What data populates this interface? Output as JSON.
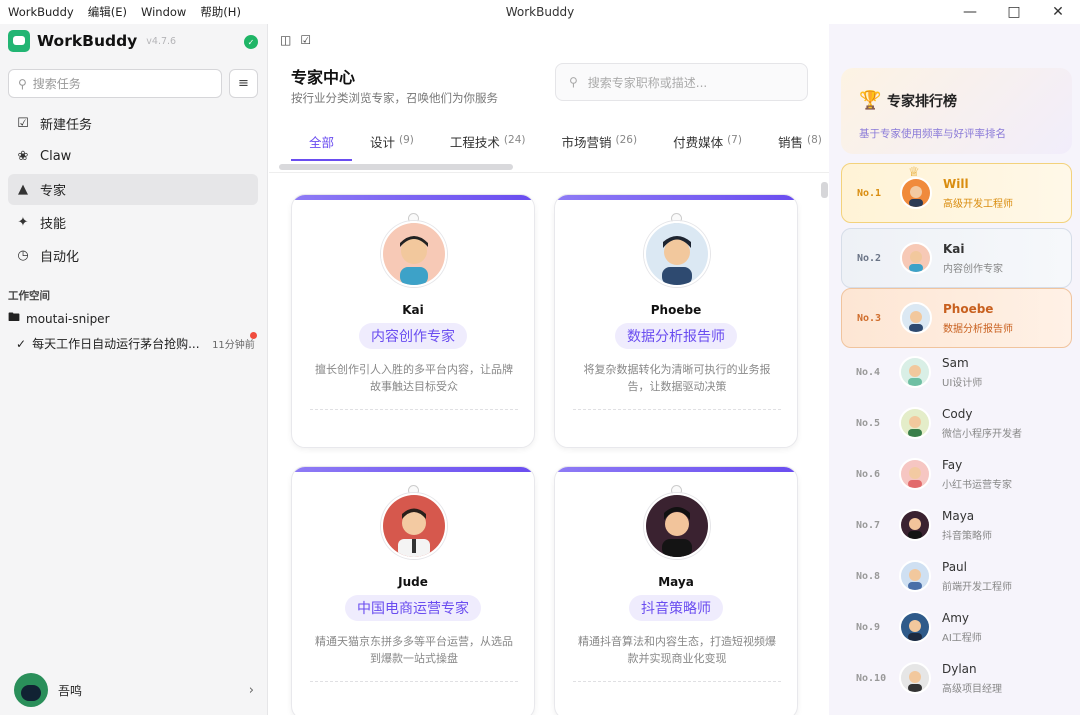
{
  "titlebar": {
    "menu": [
      "WorkBuddy",
      "编辑(E)",
      "Window",
      "帮助(H)"
    ],
    "title": "WorkBuddy"
  },
  "sidebar": {
    "brand": "WorkBuddy",
    "version": "v4.7.6",
    "search_placeholder": "搜索任务",
    "nav": [
      {
        "label": "新建任务",
        "icon": "checkbox-icon"
      },
      {
        "label": "Claw",
        "icon": "claw-icon"
      },
      {
        "label": "专家",
        "icon": "graduation-cap-icon",
        "active": true
      },
      {
        "label": "技能",
        "icon": "puzzle-icon"
      },
      {
        "label": "自动化",
        "icon": "clock-icon"
      }
    ],
    "workspace_title": "工作空间",
    "workspace_folder": "moutai-sniper",
    "task": {
      "name": "每天工作日自动运行茅台抢购...",
      "time": "11分钟前"
    },
    "user_name": "吾鸣"
  },
  "main": {
    "title": "专家中心",
    "subtitle": "按行业分类浏览专家，召唤他们为你服务",
    "search_placeholder": "搜索专家职称或描述...",
    "tabs": [
      {
        "label": "全部",
        "count": ""
      },
      {
        "label": "设计",
        "count": "(9)"
      },
      {
        "label": "工程技术",
        "count": "(24)"
      },
      {
        "label": "市场营销",
        "count": "(26)"
      },
      {
        "label": "付费媒体",
        "count": "(7)"
      },
      {
        "label": "销售",
        "count": "(8)"
      }
    ],
    "cards": [
      {
        "name": "Kai",
        "role": "内容创作专家",
        "desc": "擅长创作引人入胜的多平台内容，让品牌故事触达目标受众"
      },
      {
        "name": "Phoebe",
        "role": "数据分析报告师",
        "desc": "将复杂数据转化为清晰可执行的业务报告，让数据驱动决策"
      },
      {
        "name": "Jude",
        "role": "中国电商运营专家",
        "desc": "精通天猫京东拼多多等平台运营，从选品到爆款一站式操盘"
      },
      {
        "name": "Maya",
        "role": "抖音策略师",
        "desc": "精通抖音算法和内容生态，打造短视频爆款并实现商业化变现"
      }
    ]
  },
  "ranking": {
    "title": "专家排行榜",
    "subtitle": "基于专家使用频率与好评率排名",
    "rows": [
      {
        "no": "No.1",
        "name": "Will",
        "role": "高级开发工程师"
      },
      {
        "no": "No.2",
        "name": "Kai",
        "role": "内容创作专家"
      },
      {
        "no": "No.3",
        "name": "Phoebe",
        "role": "数据分析报告师"
      },
      {
        "no": "No.4",
        "name": "Sam",
        "role": "UI设计师"
      },
      {
        "no": "No.5",
        "name": "Cody",
        "role": "微信小程序开发者"
      },
      {
        "no": "No.6",
        "name": "Fay",
        "role": "小红书运营专家"
      },
      {
        "no": "No.7",
        "name": "Maya",
        "role": "抖音策略师"
      },
      {
        "no": "No.8",
        "name": "Paul",
        "role": "前端开发工程师"
      },
      {
        "no": "No.9",
        "name": "Amy",
        "role": "AI工程师"
      },
      {
        "no": "No.10",
        "name": "Dylan",
        "role": "高级项目经理"
      }
    ]
  },
  "colors": {
    "accent": "#6a4df0",
    "gold": "#d98d10",
    "bronze": "#c8601f",
    "brand_green": "#22b573"
  }
}
